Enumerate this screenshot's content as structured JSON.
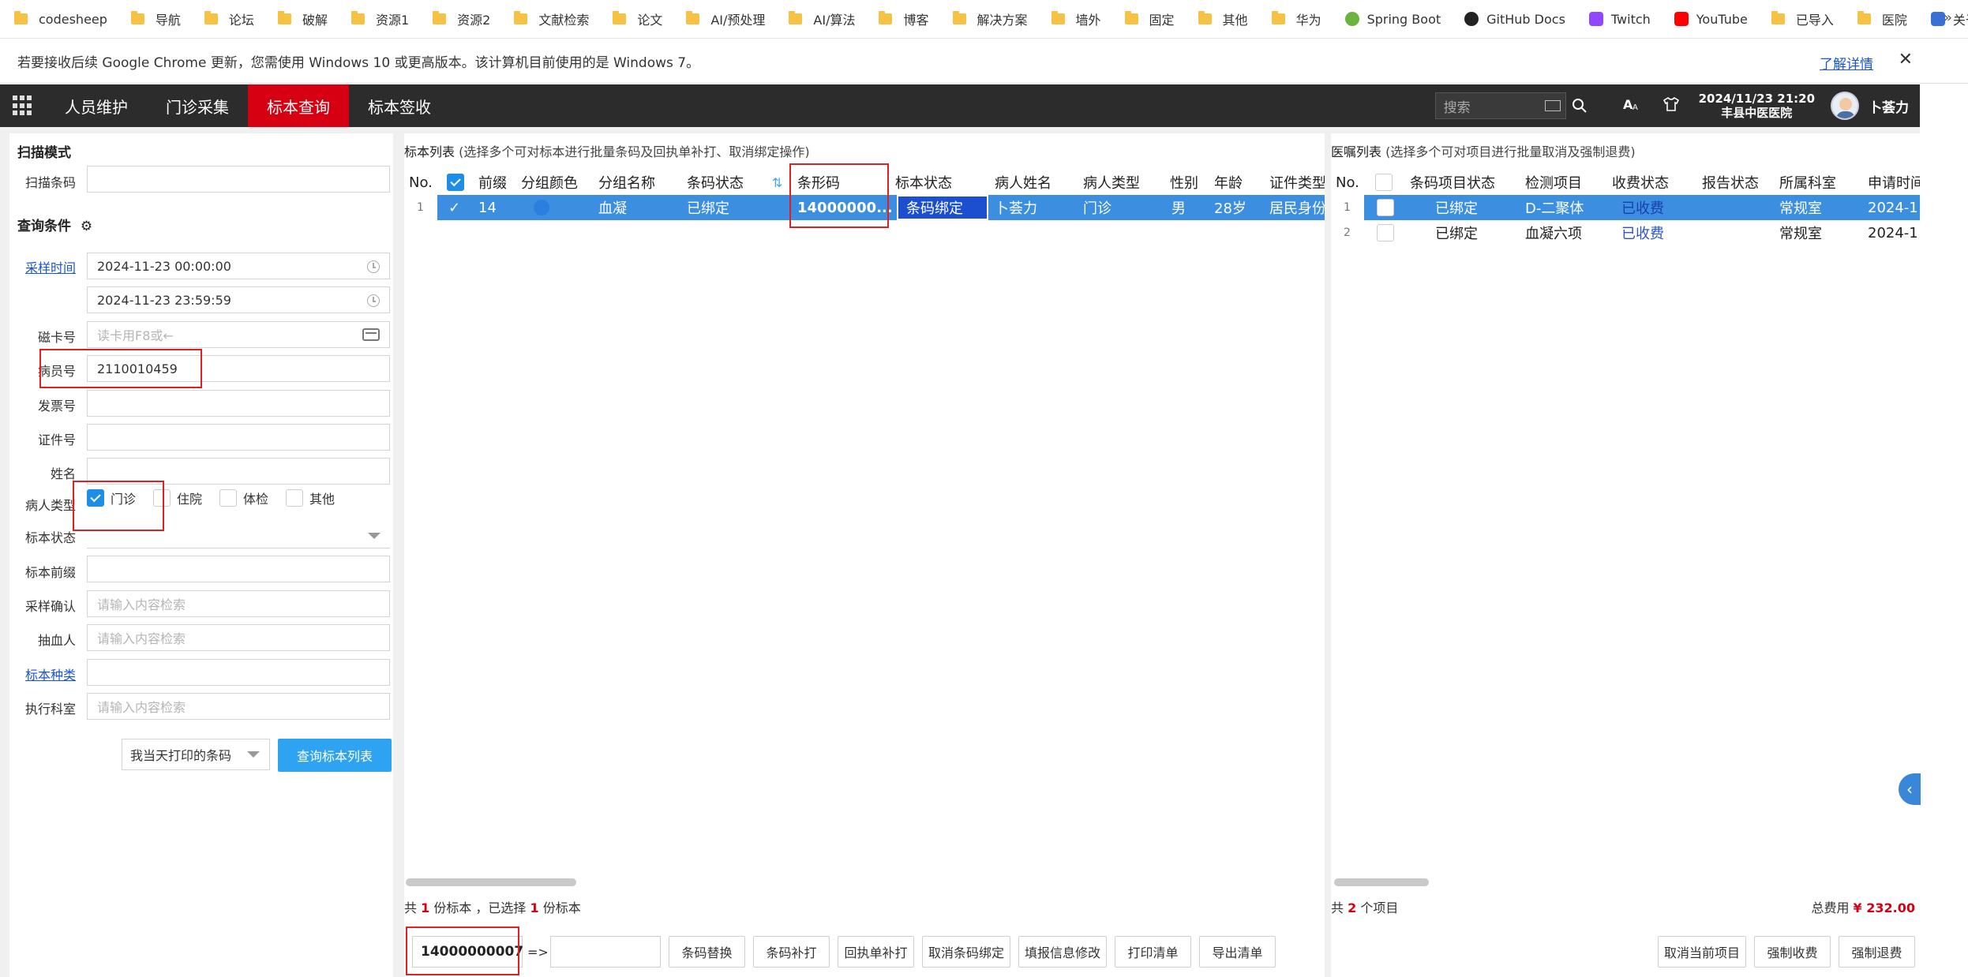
{
  "bookmarks": [
    {
      "label": "codesheep",
      "type": "folder"
    },
    {
      "label": "导航",
      "type": "folder"
    },
    {
      "label": "论坛",
      "type": "folder"
    },
    {
      "label": "破解",
      "type": "folder"
    },
    {
      "label": "资源1",
      "type": "folder"
    },
    {
      "label": "资源2",
      "type": "folder"
    },
    {
      "label": "文献检索",
      "type": "folder"
    },
    {
      "label": "论文",
      "type": "folder"
    },
    {
      "label": "AI/预处理",
      "type": "folder"
    },
    {
      "label": "AI/算法",
      "type": "folder"
    },
    {
      "label": "博客",
      "type": "folder"
    },
    {
      "label": "解决方案",
      "type": "folder"
    },
    {
      "label": "墙外",
      "type": "folder"
    },
    {
      "label": "固定",
      "type": "folder"
    },
    {
      "label": "其他",
      "type": "folder"
    },
    {
      "label": "华为",
      "type": "folder"
    },
    {
      "label": "Spring Boot",
      "type": "spring"
    },
    {
      "label": "GitHub Docs",
      "type": "github"
    },
    {
      "label": "Twitch",
      "type": "twitch"
    },
    {
      "label": "YouTube",
      "type": "youtube"
    },
    {
      "label": "已导入",
      "type": "folder"
    },
    {
      "label": "医院",
      "type": "folder"
    },
    {
      "label": "关于网络的一次推...",
      "type": "link"
    }
  ],
  "banner": {
    "text": "若要接收后续 Google Chrome 更新，您需使用 Windows 10 或更高版本。该计算机目前使用的是 Windows 7。",
    "link": "了解详情",
    "close": "✕"
  },
  "nav": {
    "tabs": [
      "人员维护",
      "门诊采集",
      "标本查询",
      "标本签收"
    ],
    "active_index": 2,
    "search_placeholder": "搜索",
    "datetime": "2024/11/23 21:20",
    "hospital": "丰县中医医院",
    "user": "卜荟力"
  },
  "left": {
    "scan_title": "扫描模式",
    "scan_label": "扫描条码",
    "query_title": "查询条件",
    "fields": {
      "collect_time_label": "采样时间",
      "start_time": "2024-11-23 00:00:00",
      "end_time": "2024-11-23 23:59:59",
      "card_label": "磁卡号",
      "card_placeholder": "读卡用F8或←",
      "patient_id_label": "病员号",
      "patient_id": "2110010459",
      "invoice_label": "发票号",
      "cert_label": "证件号",
      "name_label": "姓名",
      "patient_type_label": "病人类型",
      "status_label": "标本状态",
      "prefix_label": "标本前缀",
      "confirm_label": "采样确认",
      "confirm_placeholder": "请输入内容检索",
      "drawer_label": "抽血人",
      "drawer_placeholder": "请输入内容检索",
      "kind_label": "标本种类",
      "dept_label": "执行科室",
      "dept_placeholder": "请输入内容检索"
    },
    "patient_types": [
      {
        "label": "门诊",
        "checked": true
      },
      {
        "label": "住院",
        "checked": false
      },
      {
        "label": "体检",
        "checked": false
      },
      {
        "label": "其他",
        "checked": false
      }
    ],
    "print_select": "我当天打印的条码",
    "query_button": "查询标本列表"
  },
  "specimens": {
    "title": "标本列表",
    "hint": "(选择多个可对标本进行批量条码及回执单补打、取消绑定操作)",
    "headers": [
      "No.",
      "",
      "前缀",
      "分组颜色",
      "分组名称",
      "条码状态",
      "条形码",
      "标本状态",
      "病人姓名",
      "病人类型",
      "性别",
      "年龄",
      "证件类型"
    ],
    "rows": [
      {
        "no": "1",
        "prefix": "14",
        "color": "#2a7fe0",
        "group": "血凝",
        "barcode_status": "已绑定",
        "barcode": "14000000...",
        "status": "条码绑定",
        "name": "卜荟力",
        "ptype": "门诊",
        "sex": "男",
        "age": "28岁",
        "cert": "居民身份"
      }
    ],
    "footer_prefix": "共",
    "footer_count": "1",
    "footer_mid": "份标本 ，已选择",
    "footer_selected": "1",
    "footer_suffix": "份标本",
    "barcode_input": "14000000007",
    "arrow": "=>",
    "buttons": [
      "条码替换",
      "条码补打",
      "回执单补打",
      "取消条码绑定",
      "填报信息修改",
      "打印清单",
      "导出清单"
    ]
  },
  "orders": {
    "title": "医嘱列表",
    "hint": "(选择多个可对项目进行批量取消及强制退费)",
    "headers": [
      "No.",
      "",
      "条码项目状态",
      "检测项目",
      "收费状态",
      "报告状态",
      "所属科室",
      "申请时间"
    ],
    "rows": [
      {
        "no": "1",
        "status": "已绑定",
        "item": "D-二聚体",
        "fee": "已收费",
        "report": "",
        "dept": "常规室",
        "time": "2024-1",
        "selected": true
      },
      {
        "no": "2",
        "status": "已绑定",
        "item": "血凝六项",
        "fee": "已收费",
        "report": "",
        "dept": "常规室",
        "time": "2024-1",
        "selected": false
      }
    ],
    "footer_prefix": "共",
    "footer_count": "2",
    "footer_suffix": "个项目",
    "total_label": "总费用",
    "total_value": "¥ 232.00",
    "buttons": [
      "取消当前项目",
      "强制收费",
      "强制退费"
    ]
  },
  "colors": {
    "nav_bg": "#2c2c2c",
    "nav_active": "#d70012",
    "row_selected": "#3c8ee0",
    "primary_button": "#2ea3f2",
    "link": "#1a55d6"
  }
}
